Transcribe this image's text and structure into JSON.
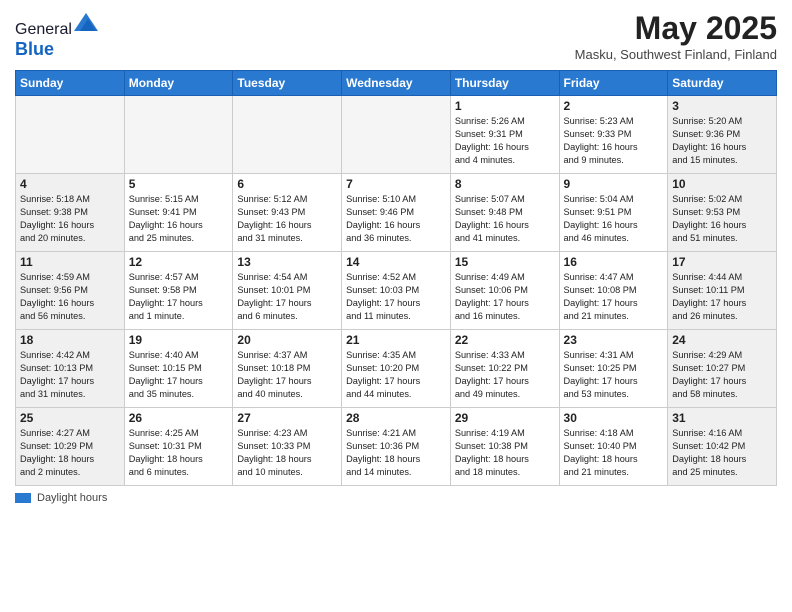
{
  "header": {
    "logo_general": "General",
    "logo_blue": "Blue",
    "month_title": "May 2025",
    "location": "Masku, Southwest Finland, Finland"
  },
  "weekdays": [
    "Sunday",
    "Monday",
    "Tuesday",
    "Wednesday",
    "Thursday",
    "Friday",
    "Saturday"
  ],
  "legend": {
    "label": "Daylight hours"
  },
  "weeks": [
    [
      {
        "day": "",
        "info": "",
        "empty": true
      },
      {
        "day": "",
        "info": "",
        "empty": true
      },
      {
        "day": "",
        "info": "",
        "empty": true
      },
      {
        "day": "",
        "info": "",
        "empty": true
      },
      {
        "day": "1",
        "info": "Sunrise: 5:26 AM\nSunset: 9:31 PM\nDaylight: 16 hours\nand 4 minutes."
      },
      {
        "day": "2",
        "info": "Sunrise: 5:23 AM\nSunset: 9:33 PM\nDaylight: 16 hours\nand 9 minutes."
      },
      {
        "day": "3",
        "info": "Sunrise: 5:20 AM\nSunset: 9:36 PM\nDaylight: 16 hours\nand 15 minutes."
      }
    ],
    [
      {
        "day": "4",
        "info": "Sunrise: 5:18 AM\nSunset: 9:38 PM\nDaylight: 16 hours\nand 20 minutes."
      },
      {
        "day": "5",
        "info": "Sunrise: 5:15 AM\nSunset: 9:41 PM\nDaylight: 16 hours\nand 25 minutes."
      },
      {
        "day": "6",
        "info": "Sunrise: 5:12 AM\nSunset: 9:43 PM\nDaylight: 16 hours\nand 31 minutes."
      },
      {
        "day": "7",
        "info": "Sunrise: 5:10 AM\nSunset: 9:46 PM\nDaylight: 16 hours\nand 36 minutes."
      },
      {
        "day": "8",
        "info": "Sunrise: 5:07 AM\nSunset: 9:48 PM\nDaylight: 16 hours\nand 41 minutes."
      },
      {
        "day": "9",
        "info": "Sunrise: 5:04 AM\nSunset: 9:51 PM\nDaylight: 16 hours\nand 46 minutes."
      },
      {
        "day": "10",
        "info": "Sunrise: 5:02 AM\nSunset: 9:53 PM\nDaylight: 16 hours\nand 51 minutes."
      }
    ],
    [
      {
        "day": "11",
        "info": "Sunrise: 4:59 AM\nSunset: 9:56 PM\nDaylight: 16 hours\nand 56 minutes."
      },
      {
        "day": "12",
        "info": "Sunrise: 4:57 AM\nSunset: 9:58 PM\nDaylight: 17 hours\nand 1 minute."
      },
      {
        "day": "13",
        "info": "Sunrise: 4:54 AM\nSunset: 10:01 PM\nDaylight: 17 hours\nand 6 minutes."
      },
      {
        "day": "14",
        "info": "Sunrise: 4:52 AM\nSunset: 10:03 PM\nDaylight: 17 hours\nand 11 minutes."
      },
      {
        "day": "15",
        "info": "Sunrise: 4:49 AM\nSunset: 10:06 PM\nDaylight: 17 hours\nand 16 minutes."
      },
      {
        "day": "16",
        "info": "Sunrise: 4:47 AM\nSunset: 10:08 PM\nDaylight: 17 hours\nand 21 minutes."
      },
      {
        "day": "17",
        "info": "Sunrise: 4:44 AM\nSunset: 10:11 PM\nDaylight: 17 hours\nand 26 minutes."
      }
    ],
    [
      {
        "day": "18",
        "info": "Sunrise: 4:42 AM\nSunset: 10:13 PM\nDaylight: 17 hours\nand 31 minutes."
      },
      {
        "day": "19",
        "info": "Sunrise: 4:40 AM\nSunset: 10:15 PM\nDaylight: 17 hours\nand 35 minutes."
      },
      {
        "day": "20",
        "info": "Sunrise: 4:37 AM\nSunset: 10:18 PM\nDaylight: 17 hours\nand 40 minutes."
      },
      {
        "day": "21",
        "info": "Sunrise: 4:35 AM\nSunset: 10:20 PM\nDaylight: 17 hours\nand 44 minutes."
      },
      {
        "day": "22",
        "info": "Sunrise: 4:33 AM\nSunset: 10:22 PM\nDaylight: 17 hours\nand 49 minutes."
      },
      {
        "day": "23",
        "info": "Sunrise: 4:31 AM\nSunset: 10:25 PM\nDaylight: 17 hours\nand 53 minutes."
      },
      {
        "day": "24",
        "info": "Sunrise: 4:29 AM\nSunset: 10:27 PM\nDaylight: 17 hours\nand 58 minutes."
      }
    ],
    [
      {
        "day": "25",
        "info": "Sunrise: 4:27 AM\nSunset: 10:29 PM\nDaylight: 18 hours\nand 2 minutes."
      },
      {
        "day": "26",
        "info": "Sunrise: 4:25 AM\nSunset: 10:31 PM\nDaylight: 18 hours\nand 6 minutes."
      },
      {
        "day": "27",
        "info": "Sunrise: 4:23 AM\nSunset: 10:33 PM\nDaylight: 18 hours\nand 10 minutes."
      },
      {
        "day": "28",
        "info": "Sunrise: 4:21 AM\nSunset: 10:36 PM\nDaylight: 18 hours\nand 14 minutes."
      },
      {
        "day": "29",
        "info": "Sunrise: 4:19 AM\nSunset: 10:38 PM\nDaylight: 18 hours\nand 18 minutes."
      },
      {
        "day": "30",
        "info": "Sunrise: 4:18 AM\nSunset: 10:40 PM\nDaylight: 18 hours\nand 21 minutes."
      },
      {
        "day": "31",
        "info": "Sunrise: 4:16 AM\nSunset: 10:42 PM\nDaylight: 18 hours\nand 25 minutes."
      }
    ]
  ]
}
